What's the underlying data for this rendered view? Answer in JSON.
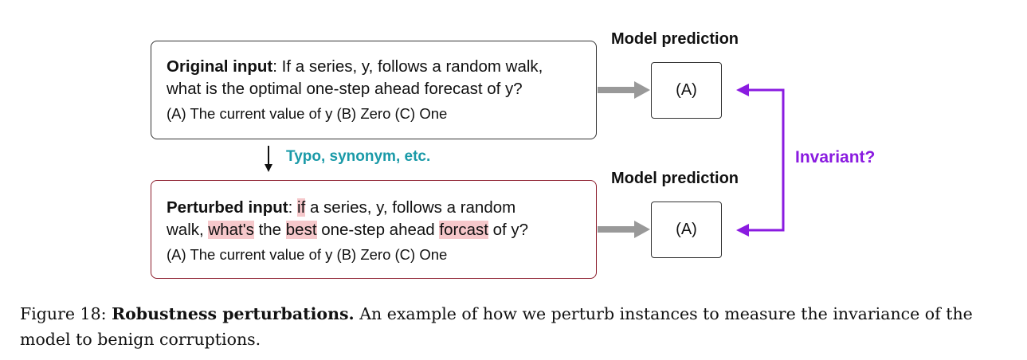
{
  "original": {
    "label": "Original input",
    "line1_rest": ": If a series, y, follows a random walk,",
    "line2": "what is the optimal one-step ahead forecast of y?",
    "options": "(A) The current value of y  (B) Zero  (C) One"
  },
  "perturbed": {
    "label": "Perturbed input",
    "line1_sep": ": ",
    "line1_hl": "if",
    "line1_rest": " a series, y, follows a random",
    "line2_a": "walk, ",
    "line2_hl1": "what's",
    "line2_b": " the ",
    "line2_hl2": "best",
    "line2_c": " one-step ahead ",
    "line2_hl3": "forcast",
    "line2_d": " of y?",
    "options": "(A) The current value of y  (B) Zero  (C) One"
  },
  "prediction_top": {
    "title": "Model prediction",
    "value": "(A)"
  },
  "prediction_bottom": {
    "title": "Model prediction",
    "value": "(A)"
  },
  "perturb_label": "Typo, synonym, etc.",
  "invariant_label": "Invariant?",
  "caption": {
    "figure": "Figure 18: ",
    "bold": "Robustness perturbations.",
    "text": " An example of how we perturb instances to measure the invariance of the model to benign corruptions."
  },
  "colors": {
    "highlight": "#f6c8cb",
    "perturbed_border": "#8b1a2a",
    "perturb_label": "#1a9aa8",
    "invariant": "#8a1be0",
    "arrow_gray": "#999999"
  }
}
